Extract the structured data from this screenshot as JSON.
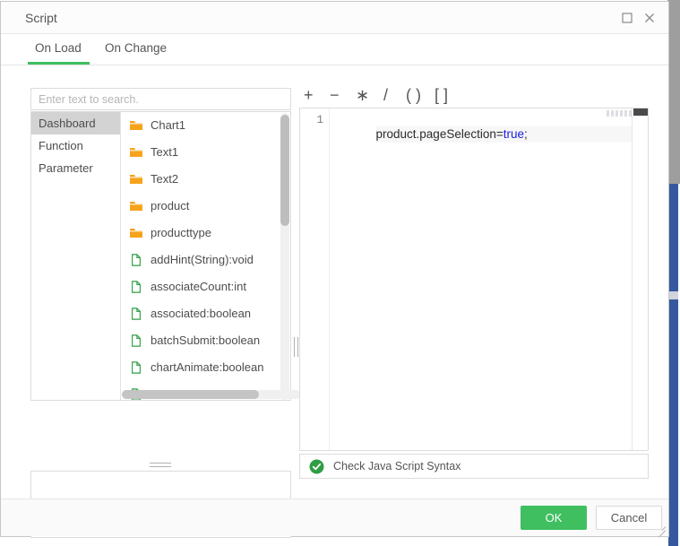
{
  "window": {
    "title": "Script",
    "maximize_icon": "maximize-square-icon",
    "close_icon": "close-x-icon",
    "accent_green": "#3fbf60"
  },
  "tabs": [
    {
      "label": "On Load",
      "active": true
    },
    {
      "label": "On Change",
      "active": false
    }
  ],
  "left_panel": {
    "search": {
      "value": "",
      "placeholder": "Enter text to search."
    },
    "categories": [
      {
        "label": "Dashboard",
        "selected": true
      },
      {
        "label": "Function",
        "selected": false
      },
      {
        "label": "Parameter",
        "selected": false
      }
    ],
    "nodes": [
      {
        "label": "Chart1",
        "icon": "folder-icon"
      },
      {
        "label": "Text1",
        "icon": "folder-icon"
      },
      {
        "label": "Text2",
        "icon": "folder-icon"
      },
      {
        "label": "product",
        "icon": "folder-icon"
      },
      {
        "label": "producttype",
        "icon": "folder-icon"
      },
      {
        "label": "addHint(String):void",
        "icon": "file-icon"
      },
      {
        "label": "associateCount:int",
        "icon": "file-icon"
      },
      {
        "label": "associated:boolean",
        "icon": "file-icon"
      },
      {
        "label": "batchSubmit:boolean",
        "icon": "file-icon"
      },
      {
        "label": "chartAnimate:boolean",
        "icon": "file-icon"
      },
      {
        "label": "",
        "icon": "file-icon"
      }
    ],
    "description": ""
  },
  "editor": {
    "toolbar": [
      {
        "label": "+",
        "name": "operator-plus"
      },
      {
        "label": "−",
        "name": "operator-minus"
      },
      {
        "label": "∗",
        "name": "operator-multiply"
      },
      {
        "label": "/",
        "name": "operator-divide"
      },
      {
        "label": "( )",
        "name": "operator-parentheses"
      },
      {
        "label": "[ ]",
        "name": "operator-brackets"
      }
    ],
    "line_number": "1",
    "code": {
      "prefix": "product.pageSelection=",
      "keyword": "true",
      "suffix": ";"
    },
    "syntax_check_label": "Check Java Script Syntax",
    "syntax_check_icon": "green-check-circle-icon"
  },
  "footer": {
    "ok_label": "OK",
    "cancel_label": "Cancel"
  }
}
